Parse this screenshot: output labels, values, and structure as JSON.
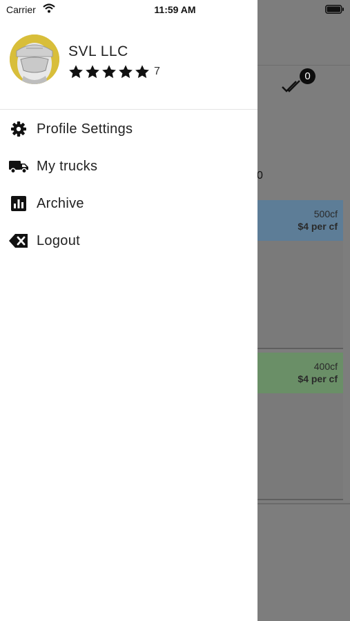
{
  "status_bar": {
    "carrier": "Carrier",
    "time": "11:59 AM"
  },
  "profile": {
    "name": "SVL LLC",
    "rating_stars": 5,
    "rating_count": "7"
  },
  "menu": [
    {
      "label": "Profile Settings",
      "icon": "gear-icon"
    },
    {
      "label": "My trucks",
      "icon": "truck-icon"
    },
    {
      "label": "Archive",
      "icon": "chart-icon"
    },
    {
      "label": "Logout",
      "icon": "backspace-icon"
    }
  ],
  "background": {
    "badge_count": "0",
    "partial_text": "0",
    "cards": [
      {
        "volume": "500cf",
        "price": "$4 per cf",
        "color": "#5d7d97"
      },
      {
        "volume": "400cf",
        "price": "$4 per cf",
        "color": "#6a8f67"
      }
    ]
  },
  "colors": {
    "overlay": "#7d7d7d",
    "drawer": "#ffffff",
    "text": "#222222"
  }
}
